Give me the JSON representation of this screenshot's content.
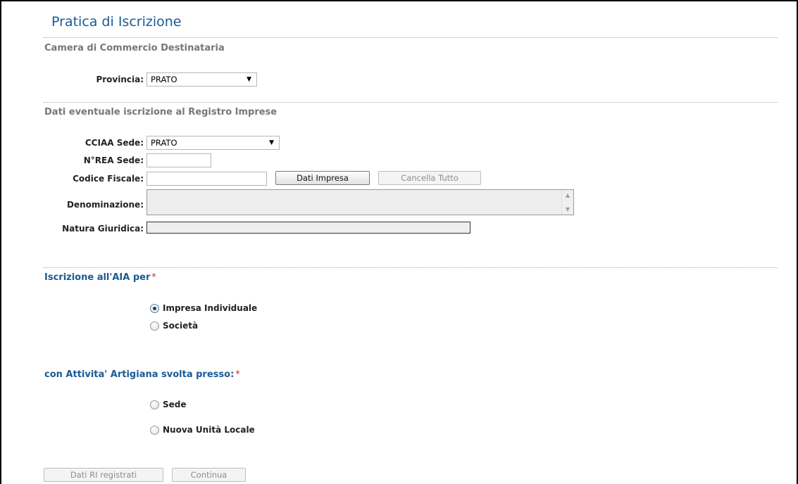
{
  "page": {
    "title": "Pratica di Iscrizione"
  },
  "camera": {
    "heading": "Camera di Commercio Destinataria",
    "provincia_label": "Provincia:",
    "provincia_value": "PRATO"
  },
  "registro": {
    "heading": "Dati eventuale iscrizione al Registro Imprese",
    "cciaa_label": "CCIAA Sede:",
    "cciaa_value": "PRATO",
    "rea_label": "N°REA Sede:",
    "rea_value": "",
    "cf_label": "Codice Fiscale:",
    "cf_value": "",
    "dati_impresa_button": "Dati Impresa",
    "cancella_button": "Cancella Tutto",
    "denominazione_label": "Denominazione:",
    "denominazione_value": "",
    "natura_label": "Natura Giuridica:",
    "natura_value": ""
  },
  "iscrizione": {
    "heading": "Iscrizione all'AIA per",
    "required_mark": "*",
    "options": [
      {
        "label": "Impresa Individuale",
        "checked": true
      },
      {
        "label": "Società",
        "checked": false
      }
    ]
  },
  "attivita": {
    "heading": "con Attivita' Artigiana svolta presso:",
    "required_mark": "*",
    "options": [
      {
        "label": "Sede",
        "checked": false
      },
      {
        "label": "Nuova Unità Locale",
        "checked": false
      }
    ]
  },
  "footer": {
    "dati_ri_button": "Dati RI registrati",
    "continua_button": "Continua"
  },
  "colors": {
    "title_blue": "#1a5a96",
    "required_red": "#d9262c",
    "section_gray": "#777777"
  },
  "icons": {
    "select_caret": "▼",
    "scroll_up": "▲",
    "scroll_down": "▼"
  }
}
